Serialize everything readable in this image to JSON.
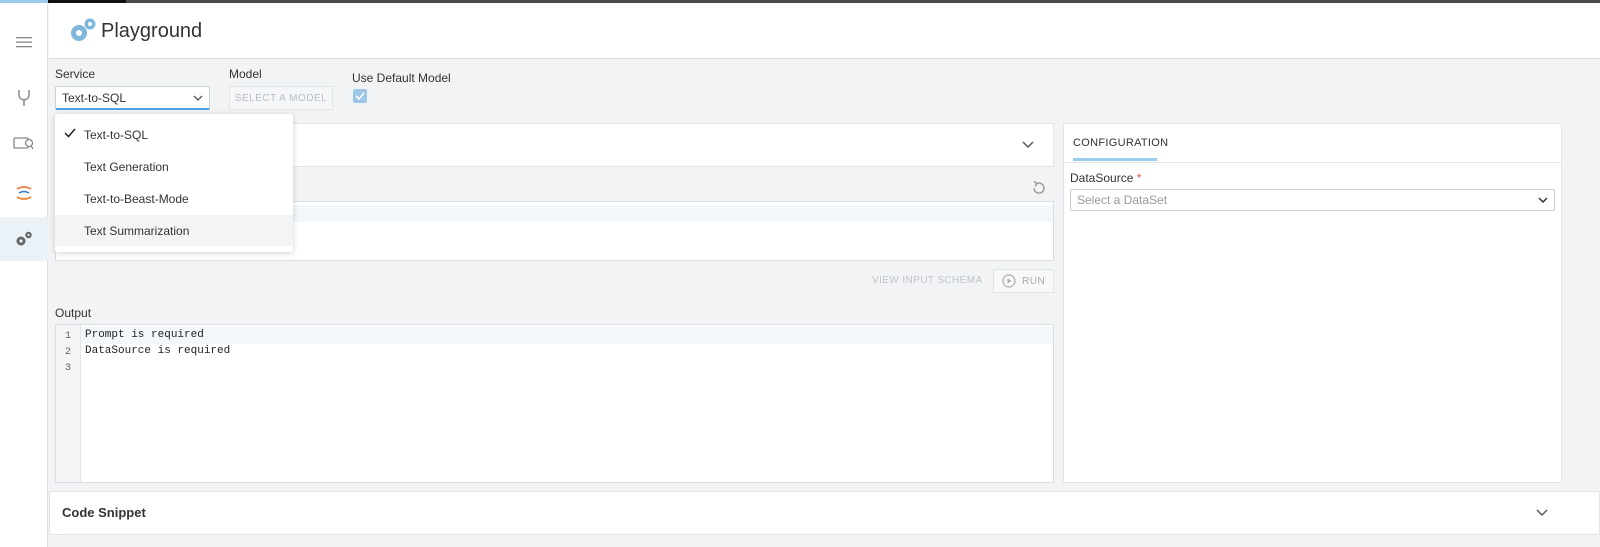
{
  "app": {
    "title": "Playground"
  },
  "sidebar": {
    "items": [
      {
        "icon": "menu-icon"
      },
      {
        "icon": "fork-icon"
      },
      {
        "icon": "dataset-icon"
      },
      {
        "icon": "ai-icon"
      },
      {
        "icon": "gears-icon",
        "active": true
      }
    ]
  },
  "controls": {
    "service_label": "Service",
    "service_value": "Text-to-SQL",
    "model_label": "Model",
    "model_button": "SELECT A MODEL",
    "default_model_label": "Use Default Model",
    "default_model_checked": true
  },
  "service_dropdown": {
    "options": [
      {
        "label": "Text-to-SQL",
        "selected": true
      },
      {
        "label": "Text Generation"
      },
      {
        "label": "Text-to-Beast-Mode"
      },
      {
        "label": "Text Summarization",
        "hovered": true
      }
    ]
  },
  "actions": {
    "view_schema": "VIEW INPUT SCHEMA",
    "run": "RUN"
  },
  "output": {
    "label": "Output",
    "lines": [
      {
        "num": "1",
        "text": "Prompt is required"
      },
      {
        "num": "2",
        "text": "DataSource is required"
      },
      {
        "num": "3",
        "text": ""
      }
    ]
  },
  "config": {
    "tab": "CONFIGURATION",
    "datasource_label": "DataSource",
    "required_mark": "*",
    "datasource_placeholder": "Select a DataSet"
  },
  "code_snippet": {
    "title": "Code Snippet"
  },
  "colors": {
    "accent": "#99ccee",
    "required": "#e05a4f"
  }
}
